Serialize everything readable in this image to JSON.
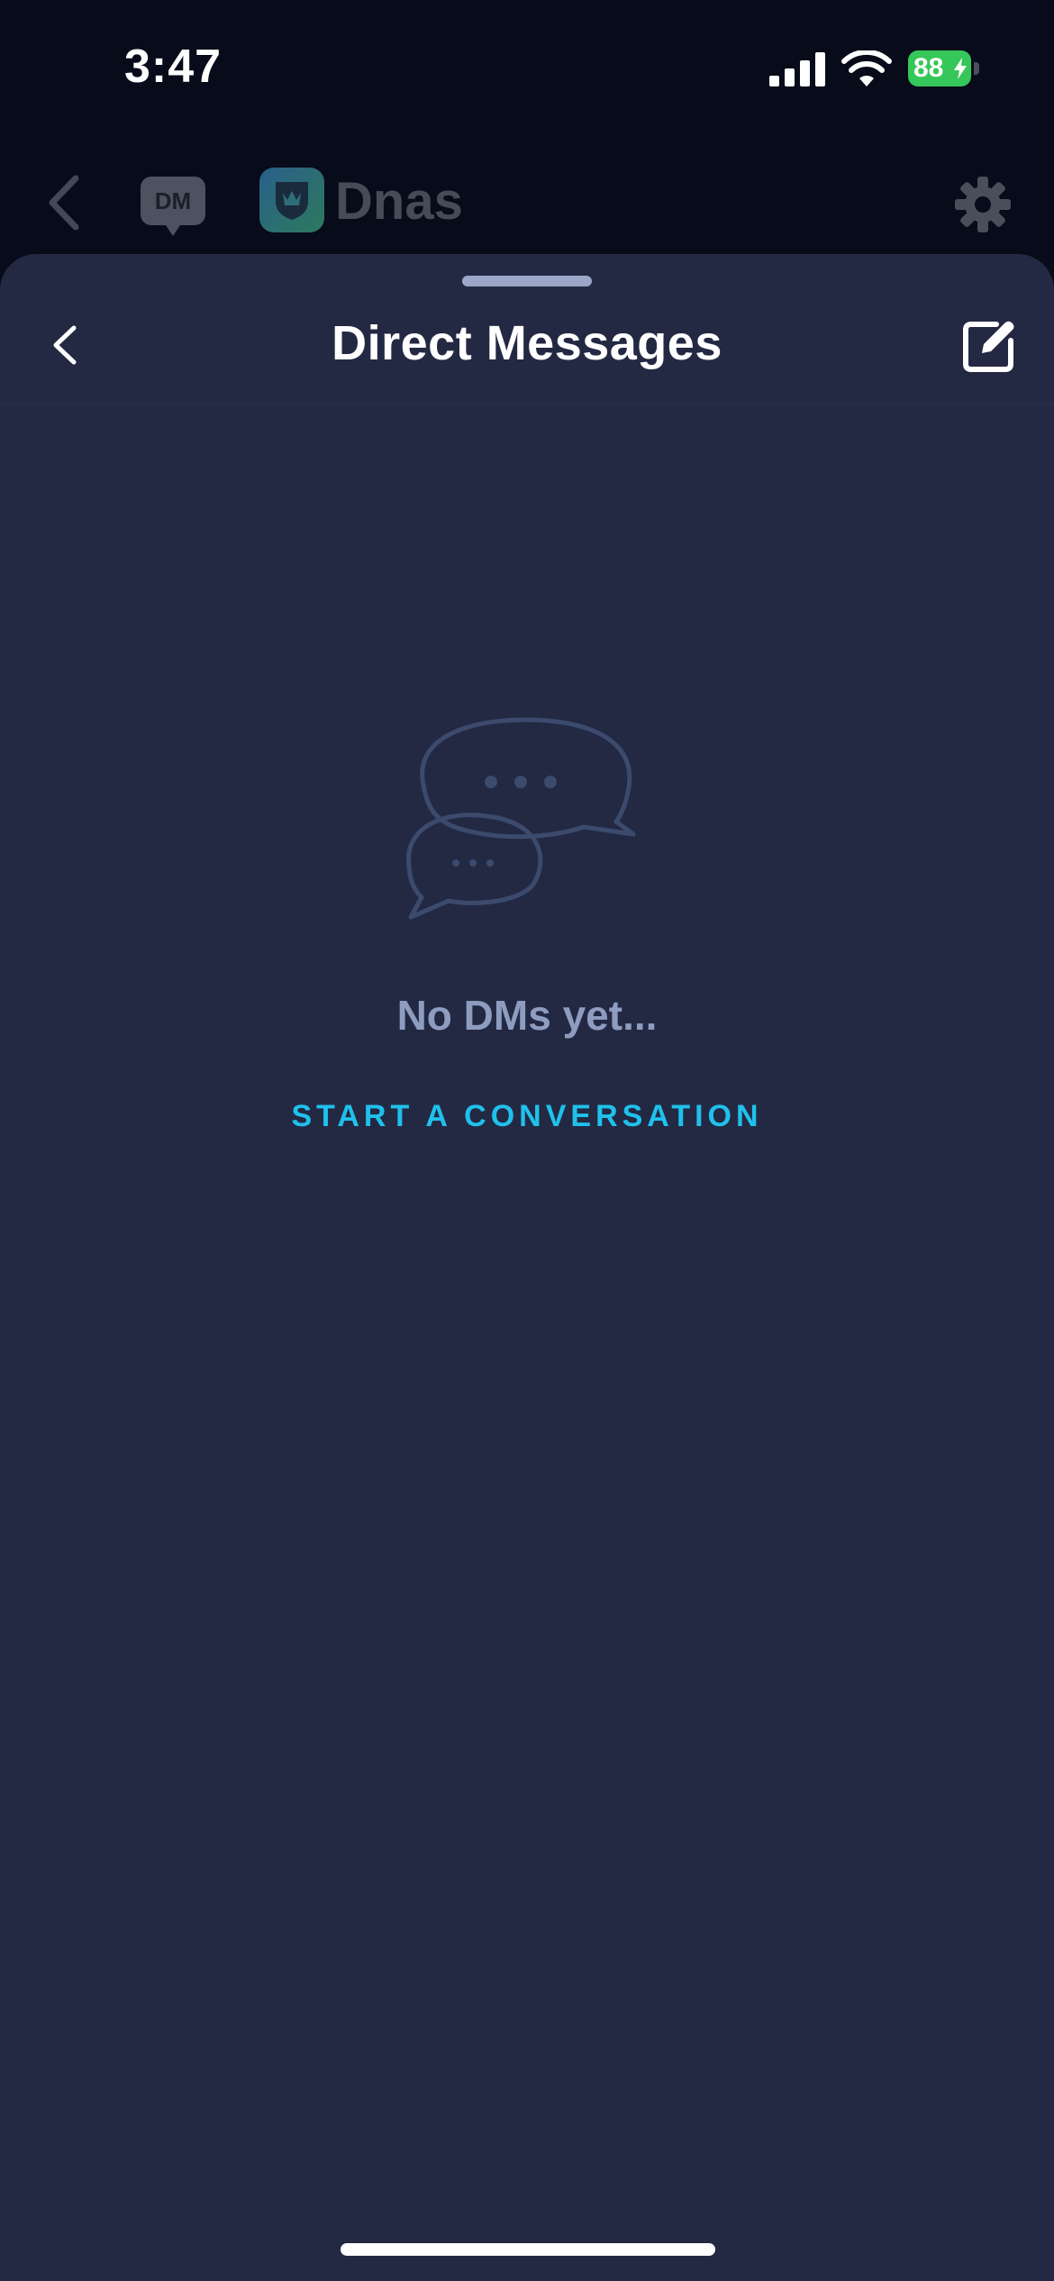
{
  "status_bar": {
    "time": "3:47",
    "battery_percent": "88",
    "battery_color": "#35c759"
  },
  "background_header": {
    "dm_badge": "DM",
    "app_name": "Dnas",
    "icons": [
      "chevron-left-icon",
      "dm-icon",
      "shield-logo-icon",
      "gear-icon"
    ]
  },
  "sheet": {
    "title": "Direct Messages",
    "back_icon": "chevron-left-icon",
    "compose_icon": "compose-icon"
  },
  "empty_state": {
    "illustration": "chat-bubbles-icon",
    "title": "No DMs yet...",
    "action_label": "START A CONVERSATION"
  },
  "colors": {
    "sheet_background": "#232943",
    "accent": "#1fc1ec",
    "muted_text": "#8e9cc0"
  }
}
